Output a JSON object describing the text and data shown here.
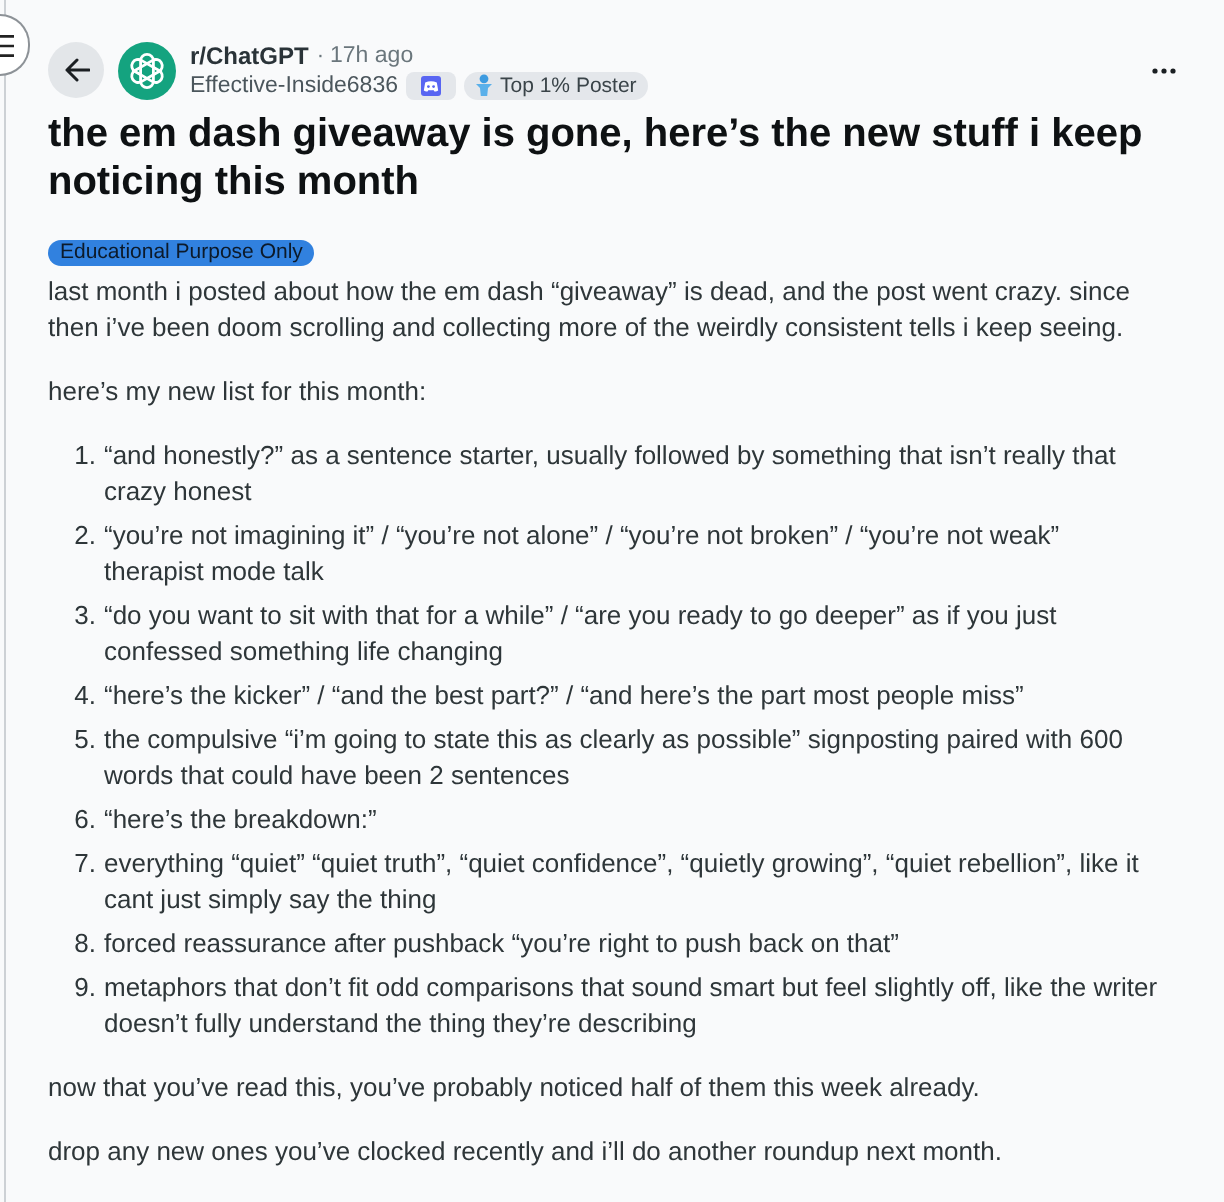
{
  "post": {
    "community": "r/ChatGPT",
    "separator": "·",
    "time": "17h ago",
    "author": "Effective-Inside6836",
    "badges": [
      {
        "kind": "icon"
      },
      {
        "kind": "label",
        "label": "Top 1% Poster"
      }
    ],
    "title": "the em dash giveaway is gone, here’s the new stuff i keep noticing this month",
    "flair": "Educational Purpose Only",
    "body": [
      {
        "kind": "paragraph",
        "text": "last month i posted about how the em dash “giveaway” is dead, and the post went crazy. since then i’ve been doom scrolling and collecting more of the weirdly consistent tells i keep seeing."
      },
      {
        "kind": "paragraph",
        "text": "here’s my new list for this month:"
      },
      {
        "kind": "list",
        "items": [
          {
            "number": "1.",
            "text": "“and honestly?” as a sentence starter, usually followed by something that isn’t really that crazy honest"
          },
          {
            "number": "2.",
            "text": "“you’re not imagining it” / “you’re not alone” / “you’re not broken” / “you’re not weak” therapist mode talk"
          },
          {
            "number": "3.",
            "text": "“do you want to sit with that for a while” / “are you ready to go deeper” as if you just confessed something life changing"
          },
          {
            "number": "4.",
            "text": "“here’s the kicker” / “and the best part?” / “and here’s the part most people miss”"
          },
          {
            "number": "5.",
            "text": "the compulsive “i’m going to state this as clearly as possible” signposting paired with 600 words that could have been 2 sentences"
          },
          {
            "number": "6.",
            "text": "“here’s the breakdown:”"
          },
          {
            "number": "7.",
            "text": "everything “quiet” “quiet truth”, “quiet confidence”, “quietly growing”, “quiet rebellion”, like it cant just simply say the thing"
          },
          {
            "number": "8.",
            "text": "forced reassurance after pushback “you’re right to push back on that”"
          },
          {
            "number": "9.",
            "text": "metaphors that don’t fit odd comparisons that sound smart but feel slightly off, like the writer doesn’t fully understand the thing they’re describing"
          }
        ]
      },
      {
        "kind": "paragraph",
        "text": "now that you’ve read this, you’ve probably noticed half of them this week already."
      },
      {
        "kind": "paragraph",
        "text": "drop any new ones you’ve clocked recently and i’ll do another roundup next month."
      }
    ]
  }
}
